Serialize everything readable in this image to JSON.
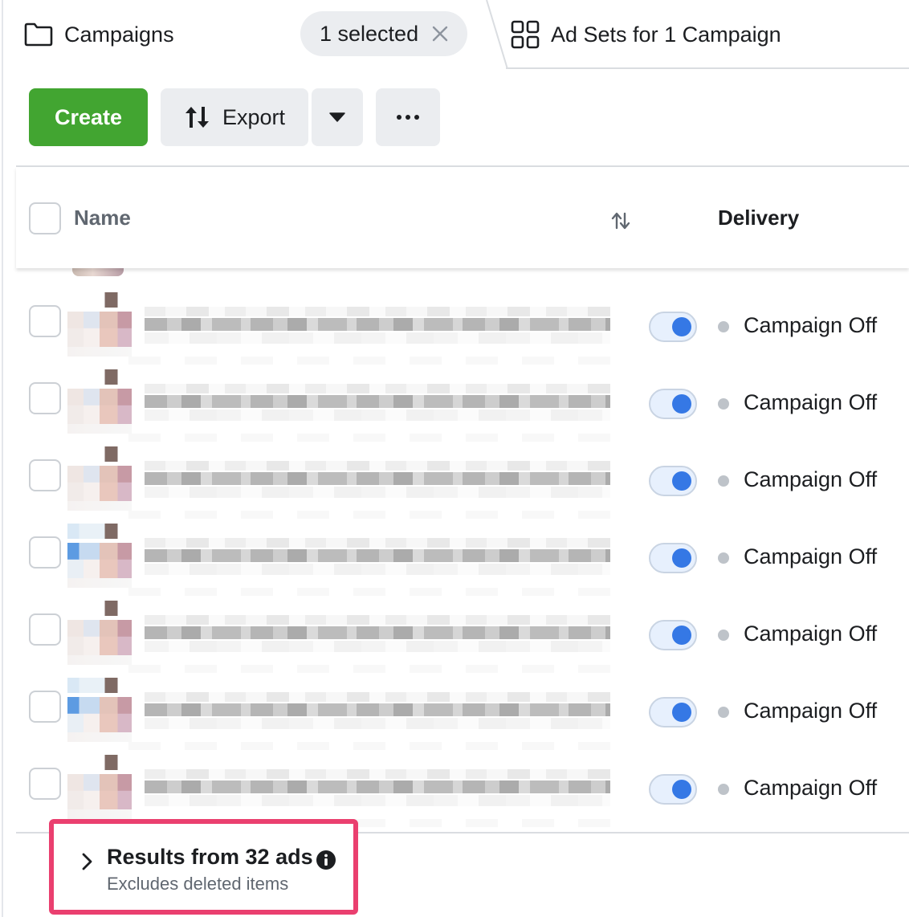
{
  "tabs": {
    "campaigns_label": "Campaigns",
    "selection_label": "1 selected",
    "adsets_label": "Ad Sets for 1 Campaign"
  },
  "toolbar": {
    "create_label": "Create",
    "export_label": "Export"
  },
  "table": {
    "columns": {
      "name": "Name",
      "delivery": "Delivery"
    },
    "rows": [
      {
        "status": "Campaign Off",
        "enabled": true,
        "thumb": "pink"
      },
      {
        "status": "Campaign Off",
        "enabled": true,
        "thumb": "pink"
      },
      {
        "status": "Campaign Off",
        "enabled": true,
        "thumb": "pink"
      },
      {
        "status": "Campaign Off",
        "enabled": true,
        "thumb": "blue"
      },
      {
        "status": "Campaign Off",
        "enabled": true,
        "thumb": "pink"
      },
      {
        "status": "Campaign Off",
        "enabled": true,
        "thumb": "blue"
      },
      {
        "status": "Campaign Off",
        "enabled": true,
        "thumb": "pink"
      }
    ]
  },
  "footer": {
    "results_title": "Results from 32 ads",
    "results_subtitle": "Excludes deleted items"
  },
  "colors": {
    "create_green": "#42a531",
    "toggle_blue": "#3578e5",
    "highlight_pink": "#ea3f6f",
    "status_off_gray": "#bec3c9"
  },
  "icons": [
    "folder-icon",
    "close-icon",
    "grid-icon",
    "export-icon",
    "caret-down-icon",
    "more-icon",
    "sort-icon",
    "chevron-right-icon",
    "info-icon"
  ]
}
